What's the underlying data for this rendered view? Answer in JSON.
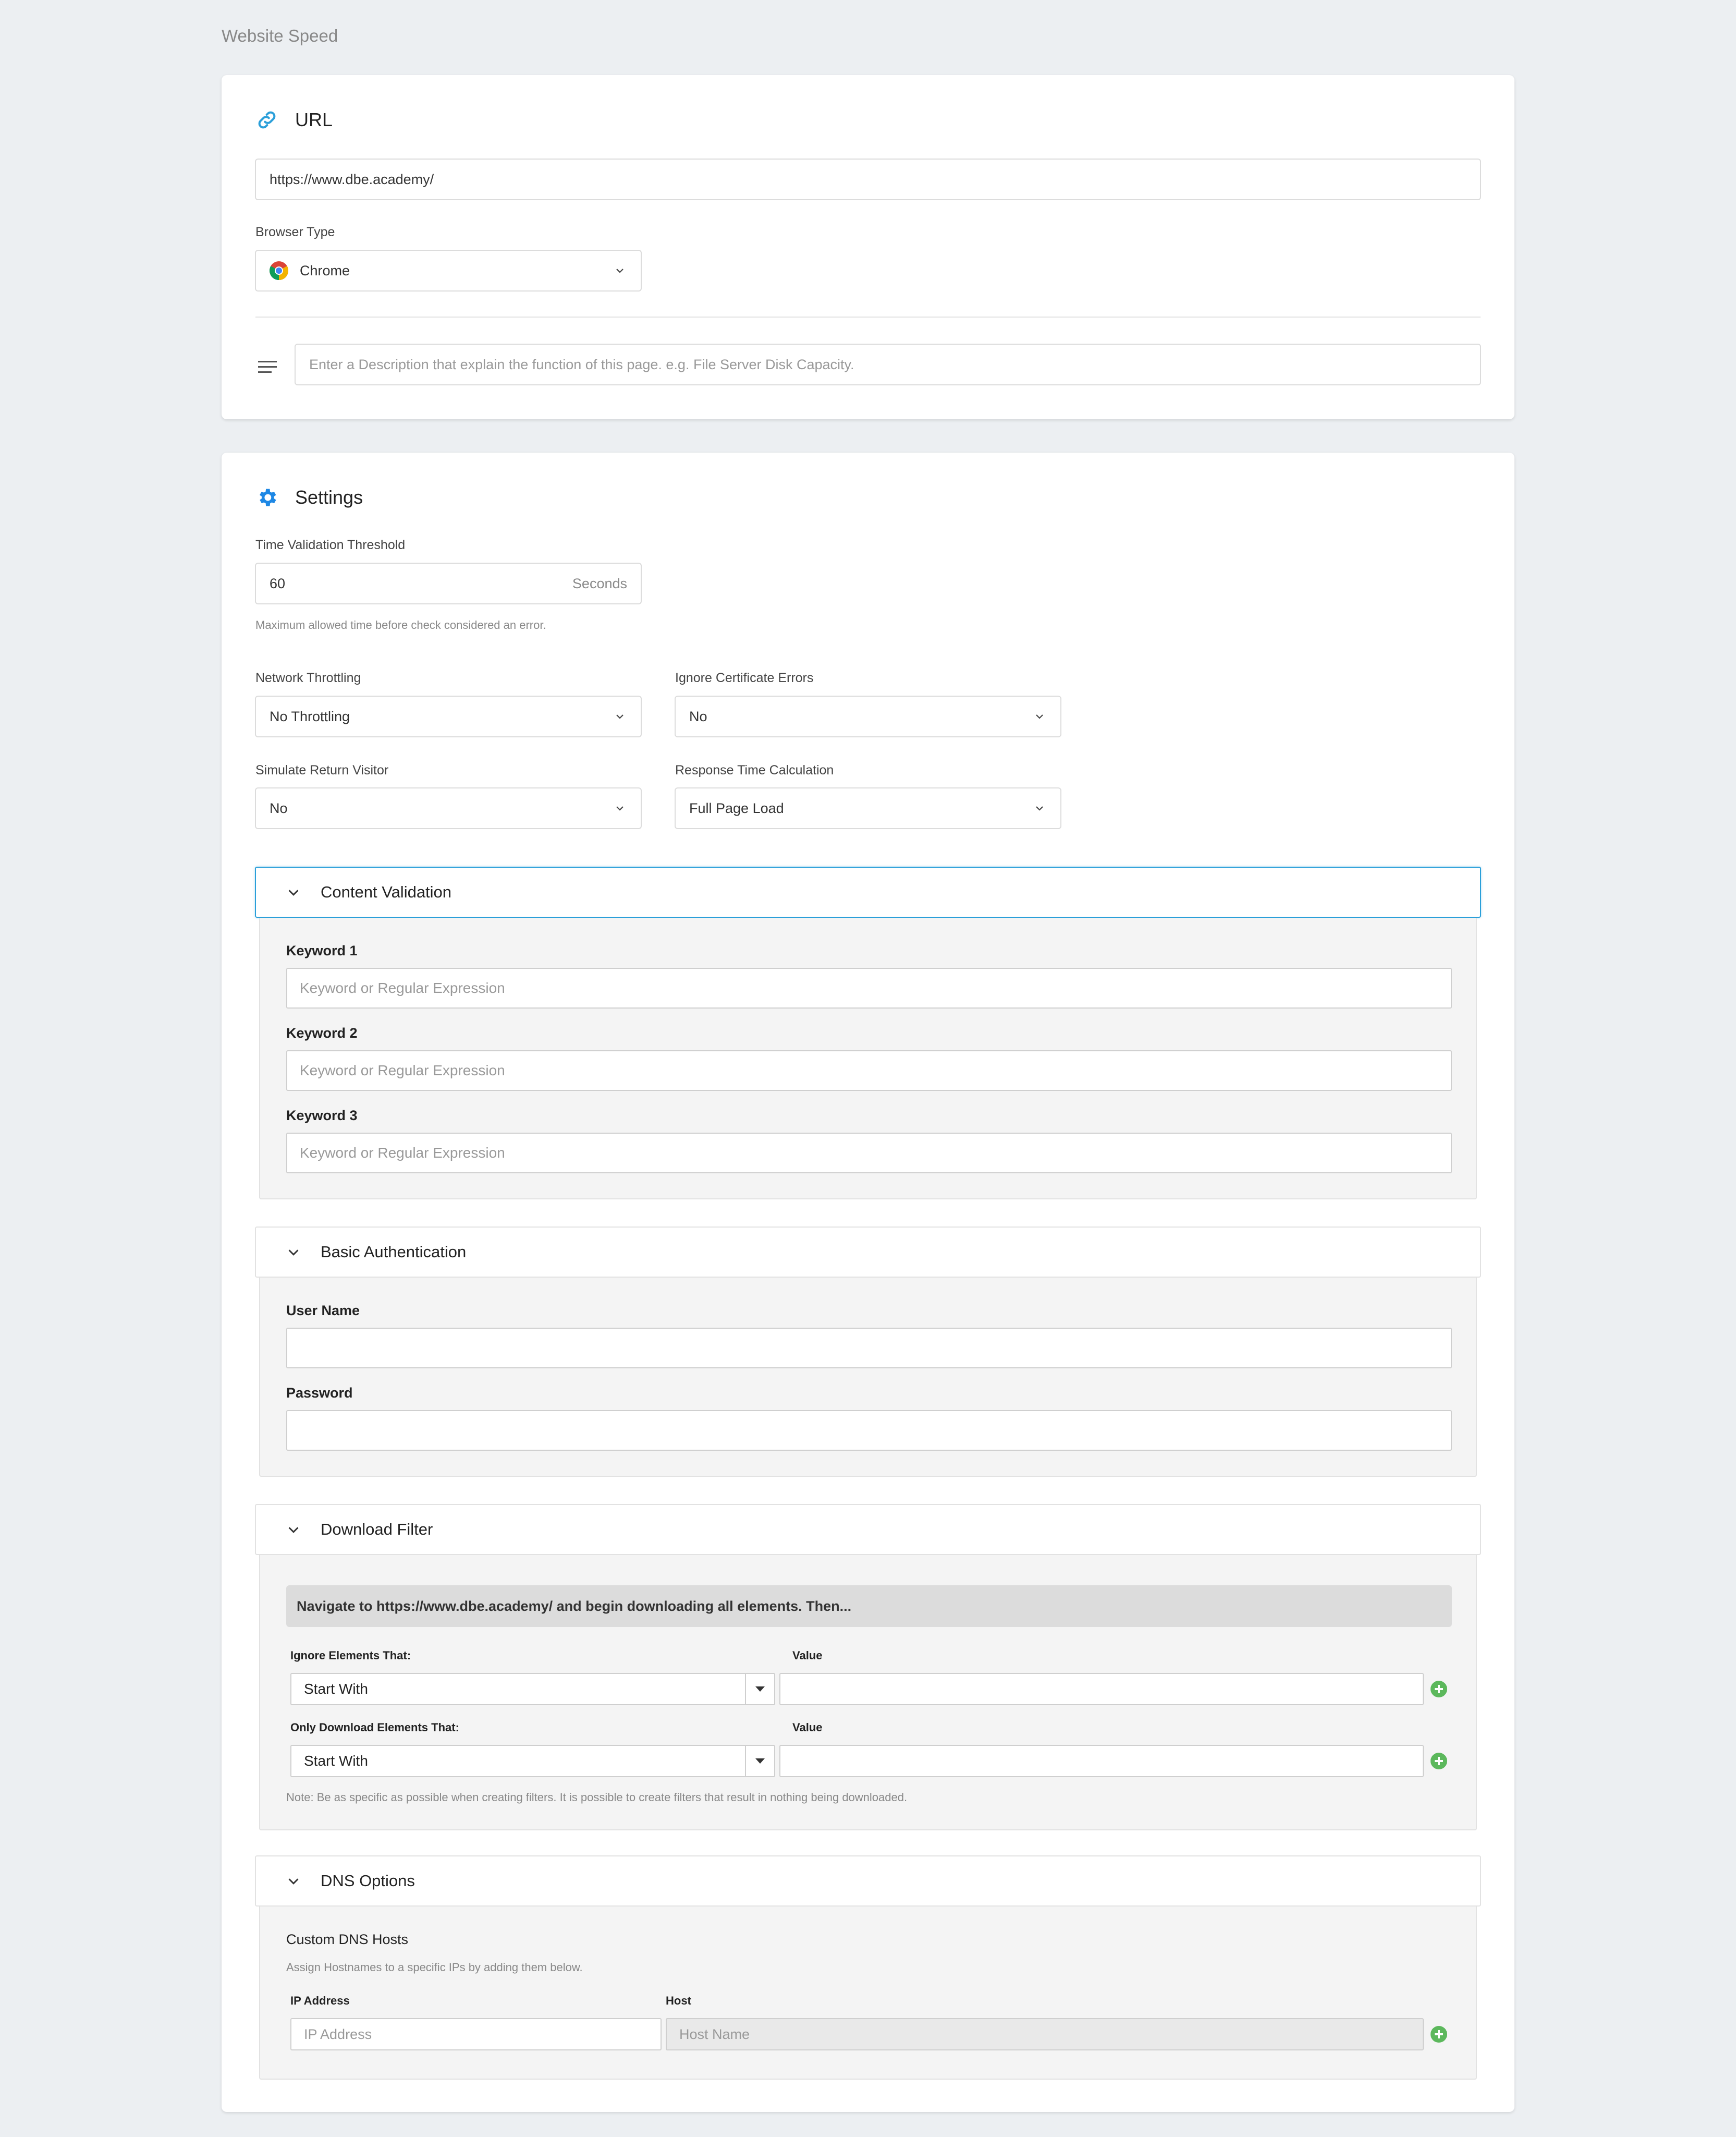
{
  "page": {
    "title": "Website Speed"
  },
  "url_card": {
    "title": "URL",
    "url_value": "https://www.dbe.academy/",
    "browser_label": "Browser Type",
    "browser_value": "Chrome",
    "description_placeholder": "Enter a Description that explain the function of this page. e.g. File Server Disk Capacity."
  },
  "settings": {
    "title": "Settings",
    "threshold_label": "Time Validation Threshold",
    "threshold_value": "60",
    "threshold_unit": "Seconds",
    "threshold_help": "Maximum allowed time before check considered an error.",
    "network_label": "Network Throttling",
    "network_value": "No Throttling",
    "cert_label": "Ignore Certificate Errors",
    "cert_value": "No",
    "visitor_label": "Simulate Return Visitor",
    "visitor_value": "No",
    "response_label": "Response Time Calculation",
    "response_value": "Full Page Load"
  },
  "content_validation": {
    "title": "Content Validation",
    "keywords": [
      {
        "label": "Keyword 1",
        "placeholder": "Keyword or Regular Expression"
      },
      {
        "label": "Keyword 2",
        "placeholder": "Keyword or Regular Expression"
      },
      {
        "label": "Keyword 3",
        "placeholder": "Keyword or Regular Expression"
      }
    ]
  },
  "basic_auth": {
    "title": "Basic Authentication",
    "username_label": "User Name",
    "password_label": "Password"
  },
  "download_filter": {
    "title": "Download Filter",
    "banner": "Navigate to https://www.dbe.academy/ and begin downloading all elements. Then...",
    "ignore_label": "Ignore Elements That:",
    "ignore_value": "Start With",
    "only_label": "Only Download Elements That:",
    "only_value": "Start With",
    "value_label": "Value",
    "note": "Note: Be as specific as possible when creating filters. It is possible to create filters that result in nothing being downloaded."
  },
  "dns_options": {
    "title": "DNS Options",
    "custom_title": "Custom DNS Hosts",
    "custom_help": "Assign Hostnames to a specific IPs by adding them below.",
    "ip_label": "IP Address",
    "host_label": "Host",
    "ip_placeholder": "IP Address",
    "host_placeholder": "Host Name"
  },
  "colors": {
    "accent": "#2b9fd9",
    "add": "#5cb85c",
    "background": "#eceff2"
  }
}
